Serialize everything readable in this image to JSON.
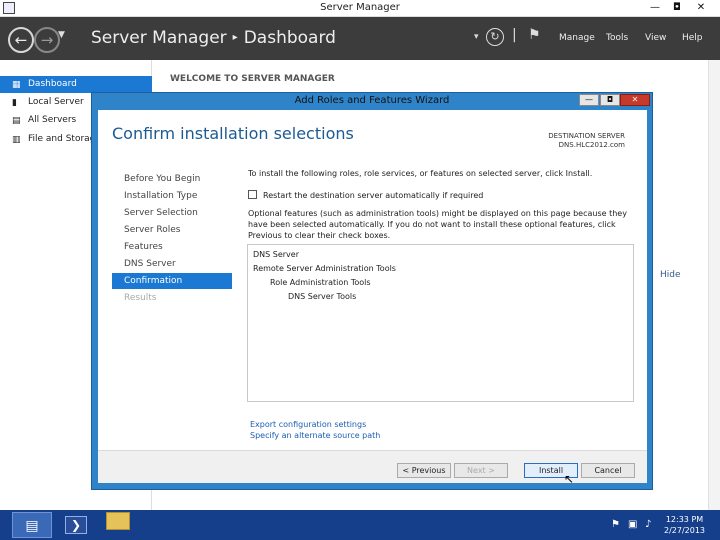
{
  "window": {
    "title": "Server Manager",
    "minimize_glyph": "—",
    "maximize_glyph": "◘",
    "close_glyph": "✕"
  },
  "header": {
    "breadcrumb_root": "Server Manager",
    "breadcrumb_sep": "▸",
    "breadcrumb_page": "Dashboard",
    "menus": [
      "Manage",
      "Tools",
      "View",
      "Help"
    ],
    "icons": [
      "back-icon",
      "forward-icon",
      "refresh-icon",
      "notifications-flag-icon"
    ]
  },
  "sidebar": {
    "items": [
      {
        "label": "Dashboard",
        "icon": "dashboard-icon",
        "glyph": "▦"
      },
      {
        "label": "Local Server",
        "icon": "server-icon",
        "glyph": "▮"
      },
      {
        "label": "All Servers",
        "icon": "servers-icon",
        "glyph": "▤"
      },
      {
        "label": "File and Storag",
        "icon": "storage-icon",
        "glyph": "▥"
      }
    ]
  },
  "content": {
    "welcome_heading": "WELCOME TO SERVER MANAGER",
    "hide_label": "Hide"
  },
  "wizard": {
    "title": "Add Roles and Features Wizard",
    "heading": "Confirm installation selections",
    "destination_label": "DESTINATION SERVER",
    "destination_value": "DNS.HLC2012.com",
    "steps": [
      {
        "label": "Before You Begin",
        "state": "normal"
      },
      {
        "label": "Installation Type",
        "state": "normal"
      },
      {
        "label": "Server Selection",
        "state": "normal"
      },
      {
        "label": "Server Roles",
        "state": "normal"
      },
      {
        "label": "Features",
        "state": "normal"
      },
      {
        "label": "DNS Server",
        "state": "normal"
      },
      {
        "label": "Confirmation",
        "state": "active"
      },
      {
        "label": "Results",
        "state": "disabled"
      }
    ],
    "intro": "To install the following roles, role services, or features on selected server, click Install.",
    "restart_label": "Restart the destination server automatically if required",
    "restart_checked": false,
    "optional_text": "Optional features (such as administration tools) might be displayed on this page because they have been selected automatically. If you do not want to install these optional features, click Previous to clear their check boxes.",
    "features": [
      {
        "label": "DNS Server",
        "level": 0
      },
      {
        "label": "Remote Server Administration Tools",
        "level": 0
      },
      {
        "label": "Role Administration Tools",
        "level": 1
      },
      {
        "label": "DNS Server Tools",
        "level": 2
      }
    ],
    "export_link": "Export configuration settings",
    "source_link": "Specify an alternate source path",
    "buttons": {
      "previous": "< Previous",
      "next": "Next >",
      "install": "Install",
      "cancel": "Cancel"
    }
  },
  "taskbar": {
    "time": "12:33 PM",
    "date": "2/27/2013",
    "apps": [
      "server-manager-icon",
      "powershell-icon",
      "file-explorer-icon"
    ]
  }
}
